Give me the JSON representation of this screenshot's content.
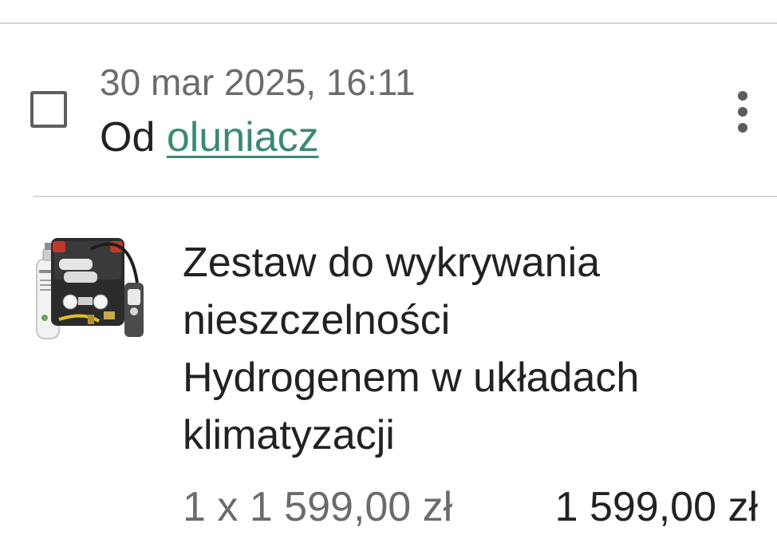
{
  "order": {
    "date": "30 mar 2025, 16:11",
    "from_prefix": "Od",
    "seller": "oluniacz",
    "menu_icon": "more-vert-icon",
    "selected": false
  },
  "item": {
    "thumbnail_icon": "hydrogen-leak-detection-kit-image",
    "title_lines": [
      "Zestaw do wykrywania",
      "nieszczelności",
      "Hydrogenem w układach",
      "klimatyzacji"
    ],
    "quantity_price": "1 x 1 599,00 zł",
    "total": "1 599,00 zł"
  },
  "colors": {
    "link": "#3a8a73",
    "text_primary": "#222222",
    "text_secondary": "#6b6b6b",
    "divider": "#d6d6d6"
  }
}
